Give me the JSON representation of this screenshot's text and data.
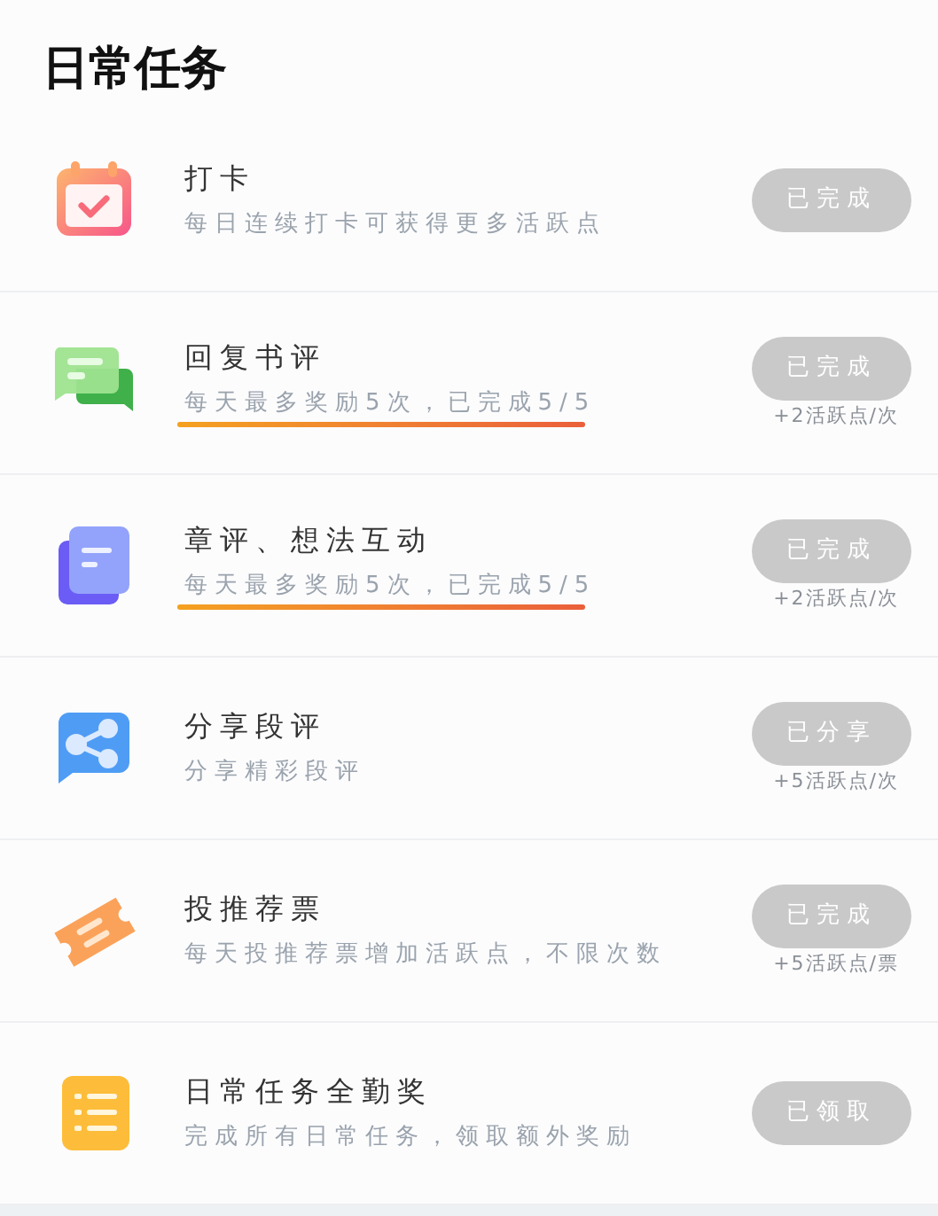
{
  "title": "日常任务",
  "tasks": [
    {
      "kind": "calendar",
      "name": "打卡",
      "description": "每日连续打卡可获得更多活跃点",
      "button": {
        "label": "已完成",
        "disabled": true
      }
    },
    {
      "kind": "chat",
      "name": "回复书评",
      "description": "每天最多奖励5次，已完成5/5",
      "progress": {
        "level": 1
      },
      "button": {
        "label": "已完成",
        "disabled": true
      },
      "reward": "+2活跃点/次"
    },
    {
      "kind": "document",
      "name": "章评、想法互动",
      "description": "每天最多奖励5次，已完成5/5",
      "progress": {
        "level": 1
      },
      "button": {
        "label": "已完成",
        "disabled": true
      },
      "reward": "+2活跃点/次"
    },
    {
      "kind": "share",
      "name": "分享段评",
      "description": "分享精彩段评",
      "button": {
        "label": "已分享",
        "disabled": true
      },
      "reward": "+5活跃点/次"
    },
    {
      "kind": "ticket",
      "name": "投推荐票",
      "description": "每天投推荐票增加活跃点，不限次数",
      "button": {
        "label": "已完成",
        "disabled": true
      },
      "reward": "+5活跃点/票"
    },
    {
      "kind": "list",
      "name": "日常任务全勤奖",
      "description": "完成所有日常任务，领取额外奖励",
      "button": {
        "label": "已领取",
        "disabled": true
      }
    }
  ]
}
